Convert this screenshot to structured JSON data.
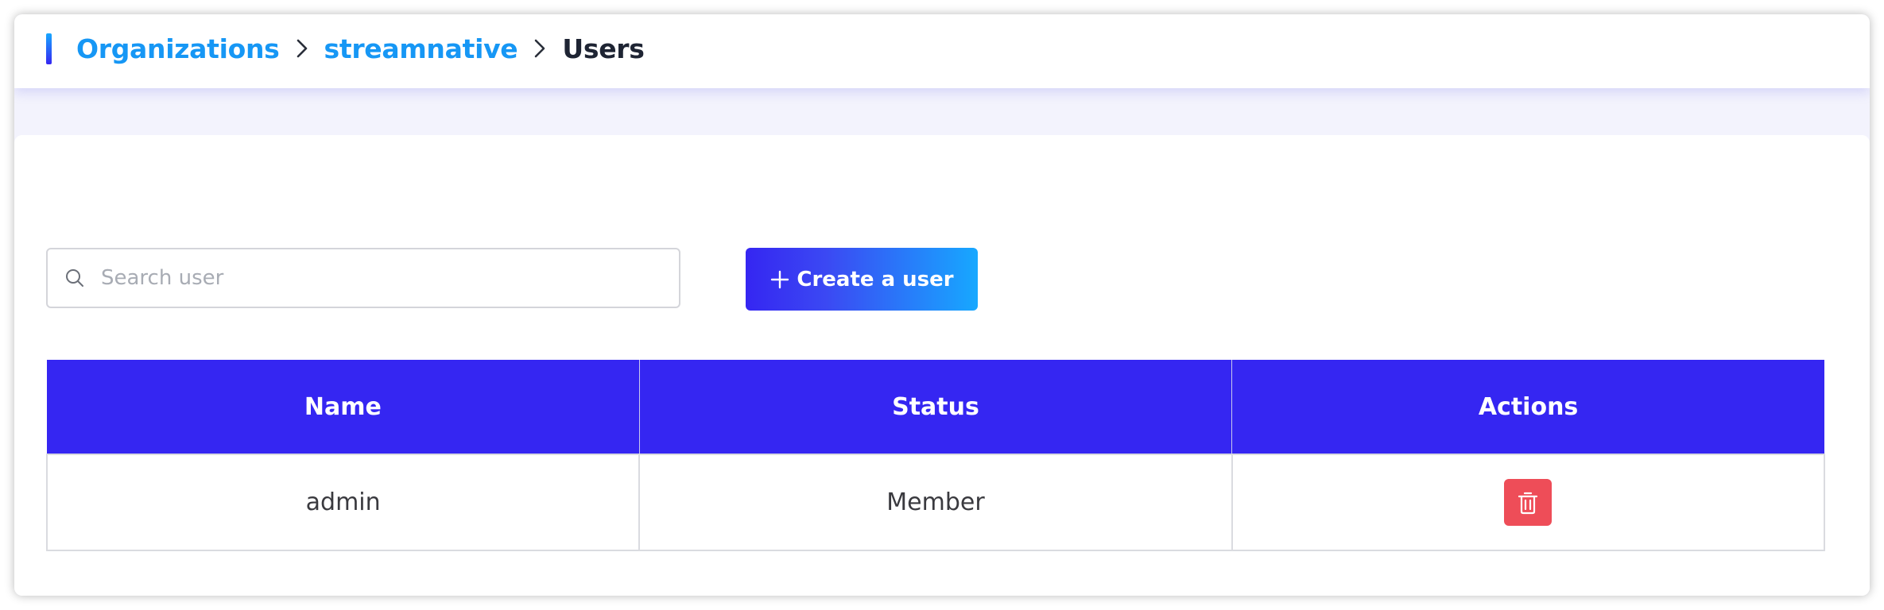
{
  "breadcrumb": {
    "items": [
      {
        "label": "Organizations"
      },
      {
        "label": "streamnative"
      },
      {
        "label": "Users"
      }
    ]
  },
  "search": {
    "placeholder": "Search user",
    "value": "",
    "icon": "search-icon"
  },
  "toolbar": {
    "create_label": "Create a user",
    "create_icon": "plus-icon"
  },
  "table": {
    "columns": [
      "Name",
      "Status",
      "Actions"
    ],
    "rows": [
      {
        "name": "admin",
        "status": "Member",
        "action_icon": "trash-icon"
      }
    ]
  },
  "colors": {
    "accent": "#3526f2",
    "link": "#1697f5",
    "gradient_end": "#17a8ff",
    "danger": "#ee4d58"
  }
}
